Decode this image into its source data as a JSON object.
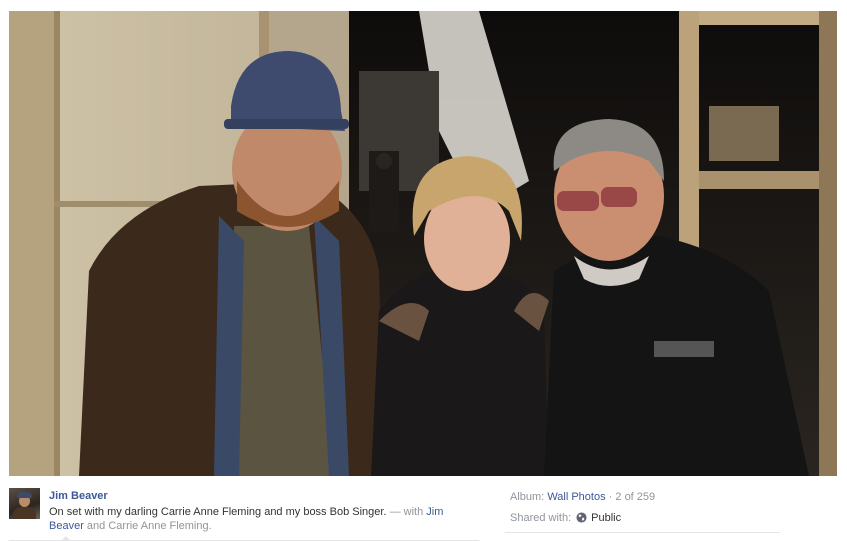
{
  "photo": {
    "description_icon": "photo-image"
  },
  "post": {
    "poster_name": "Jim Beaver",
    "caption_text": "On set with my darling Carrie Anne Fleming and my boss Bob Singer.",
    "with_separator": "— with",
    "tagged_1": "Jim Beaver",
    "tagged_join": "and",
    "tagged_2": "Carrie Anne Fleming.",
    "avatar_icon": "profile-avatar"
  },
  "meta": {
    "album_label": "Album:",
    "album_name": "Wall Photos",
    "position": "· 2 of 259",
    "shared_label": "Shared with:",
    "audience_icon": "globe-icon",
    "audience": "Public"
  },
  "colors": {
    "link": "#3b5998",
    "muted": "#90949c",
    "text": "#333333"
  }
}
